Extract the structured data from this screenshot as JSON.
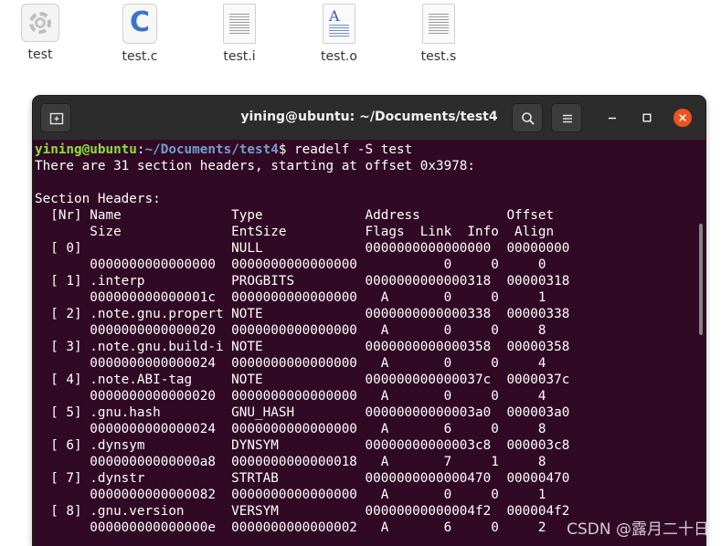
{
  "desktop": {
    "files": [
      {
        "name": "test",
        "icon": "executable-gear-icon"
      },
      {
        "name": "test.c",
        "icon": "c-source-icon",
        "glyph": "C"
      },
      {
        "name": "test.i",
        "icon": "text-document-icon"
      },
      {
        "name": "test.o",
        "icon": "object-file-icon",
        "glyph": "A"
      },
      {
        "name": "test.s",
        "icon": "text-document-icon"
      }
    ]
  },
  "terminal": {
    "title": "yining@ubuntu: ~/Documents/test4",
    "prompt": {
      "user_host": "yining@ubuntu",
      "sep": ":",
      "path": "~/Documents/test4",
      "sigil": "$",
      "command": " readelf -S test"
    },
    "lines": [
      "There are 31 section headers, starting at offset 0x3978:",
      "",
      "Section Headers:",
      "  [Nr] Name              Type             Address           Offset",
      "       Size              EntSize          Flags  Link  Info  Align",
      "  [ 0]                   NULL             0000000000000000  00000000",
      "       0000000000000000  0000000000000000           0     0     0",
      "  [ 1] .interp           PROGBITS         0000000000000318  00000318",
      "       000000000000001c  0000000000000000   A       0     0     1",
      "  [ 2] .note.gnu.propert NOTE             0000000000000338  00000338",
      "       0000000000000020  0000000000000000   A       0     0     8",
      "  [ 3] .note.gnu.build-i NOTE             0000000000000358  00000358",
      "       0000000000000024  0000000000000000   A       0     0     4",
      "  [ 4] .note.ABI-tag     NOTE             000000000000037c  0000037c",
      "       0000000000000020  0000000000000000   A       0     0     4",
      "  [ 5] .gnu.hash         GNU_HASH         00000000000003a0  000003a0",
      "       0000000000000024  0000000000000000   A       6     0     8",
      "  [ 6] .dynsym           DYNSYM           00000000000003c8  000003c8",
      "       00000000000000a8  0000000000000018   A       7     1     8",
      "  [ 7] .dynstr           STRTAB           0000000000000470  00000470",
      "       0000000000000082  0000000000000000   A       0     0     1",
      "  [ 8] .gnu.version      VERSYM           00000000000004f2  000004f2",
      "       000000000000000e  0000000000000002   A       6     0     2"
    ]
  },
  "watermark": "CSDN @露月二十日",
  "colors": {
    "terminal_bg": "#300a24",
    "titlebar_bg": "#2c2c2c",
    "prompt_user": "#8ae234",
    "prompt_path": "#729fcf",
    "close_button": "#e95420"
  }
}
